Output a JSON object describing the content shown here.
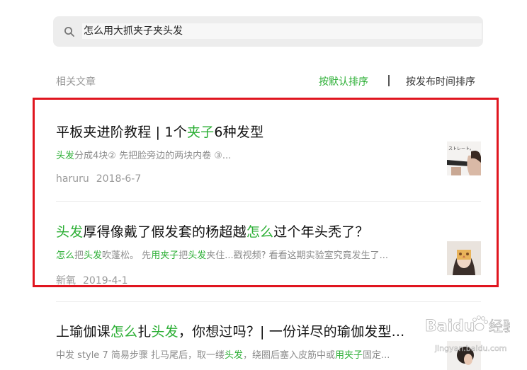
{
  "search": {
    "query": "怎么用大抓夹子夹头发"
  },
  "section": {
    "label": "相关文章",
    "sort_default": "按默认排序",
    "sort_time": "按发布时间排序"
  },
  "articles": [
    {
      "title": [
        {
          "t": "平板夹进阶教程 | 1个",
          "h": false
        },
        {
          "t": "夹子",
          "h": true
        },
        {
          "t": "6种发型",
          "h": false
        }
      ],
      "snippet": [
        {
          "t": "头发",
          "h": true
        },
        {
          "t": "分成4块② 先把脸旁边的两块内卷 ③...",
          "h": false
        }
      ],
      "author": "haruru",
      "date": "2018-6-7",
      "thumb_text": "ストレート。"
    },
    {
      "title": [
        {
          "t": "头发",
          "h": true
        },
        {
          "t": "厚得像戴了假发套的杨超越",
          "h": false
        },
        {
          "t": "怎么",
          "h": true
        },
        {
          "t": "过个年头秃了？",
          "h": false
        }
      ],
      "snippet": [
        {
          "t": "怎么",
          "h": true
        },
        {
          "t": "把",
          "h": false
        },
        {
          "t": "头发",
          "h": true
        },
        {
          "t": "吹蓬松。 先",
          "h": false
        },
        {
          "t": "用夹子",
          "h": true
        },
        {
          "t": "把",
          "h": false
        },
        {
          "t": "头发",
          "h": true
        },
        {
          "t": "夹住...戳视频? 看看这期实验室究竟发生了...",
          "h": false
        }
      ],
      "author": "新氧",
      "date": "2019-4-1"
    },
    {
      "title": [
        {
          "t": "上瑜伽课",
          "h": false
        },
        {
          "t": "怎么",
          "h": true
        },
        {
          "t": "扎",
          "h": false
        },
        {
          "t": "头发",
          "h": true
        },
        {
          "t": "，你想过吗？| 一份详尽的瑜伽发型...",
          "h": false
        }
      ],
      "snippet": [
        {
          "t": "中发 style 7 简易步骤 扎马尾后，取一缕",
          "h": false
        },
        {
          "t": "头发",
          "h": true
        },
        {
          "t": "，绕圈后塞入皮筋中或",
          "h": false
        },
        {
          "t": "用夹子",
          "h": true
        },
        {
          "t": "固定...",
          "h": false
        }
      ]
    }
  ],
  "watermark": {
    "brand": "Baidu",
    "brand_cn": "经验",
    "url": "jingyan.baidu.com"
  },
  "colors": {
    "accent": "#2aae33",
    "highlight_border": "#e0151f",
    "search_bg": "#ededed"
  }
}
